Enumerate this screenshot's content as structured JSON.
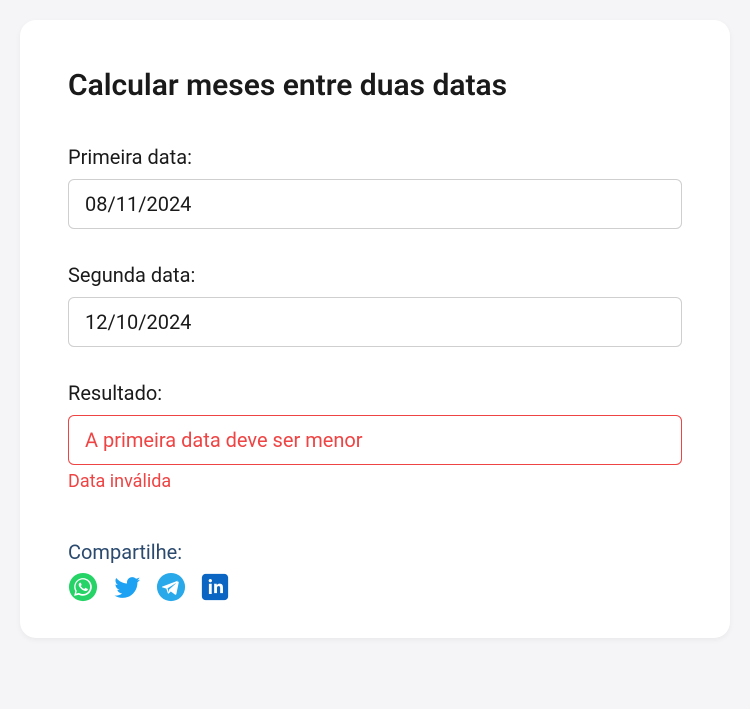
{
  "title": "Calcular meses entre duas datas",
  "first_date": {
    "label": "Primeira data:",
    "value": "08/11/2024"
  },
  "second_date": {
    "label": "Segunda data:",
    "value": "12/10/2024"
  },
  "result": {
    "label": "Resultado:",
    "value": "A primeira data deve ser menor",
    "hint": "Data inválida"
  },
  "share": {
    "title": "Compartilhe:",
    "icons": {
      "whatsapp": "whatsapp-icon",
      "twitter": "twitter-icon",
      "telegram": "telegram-icon",
      "linkedin": "linkedin-icon"
    }
  }
}
